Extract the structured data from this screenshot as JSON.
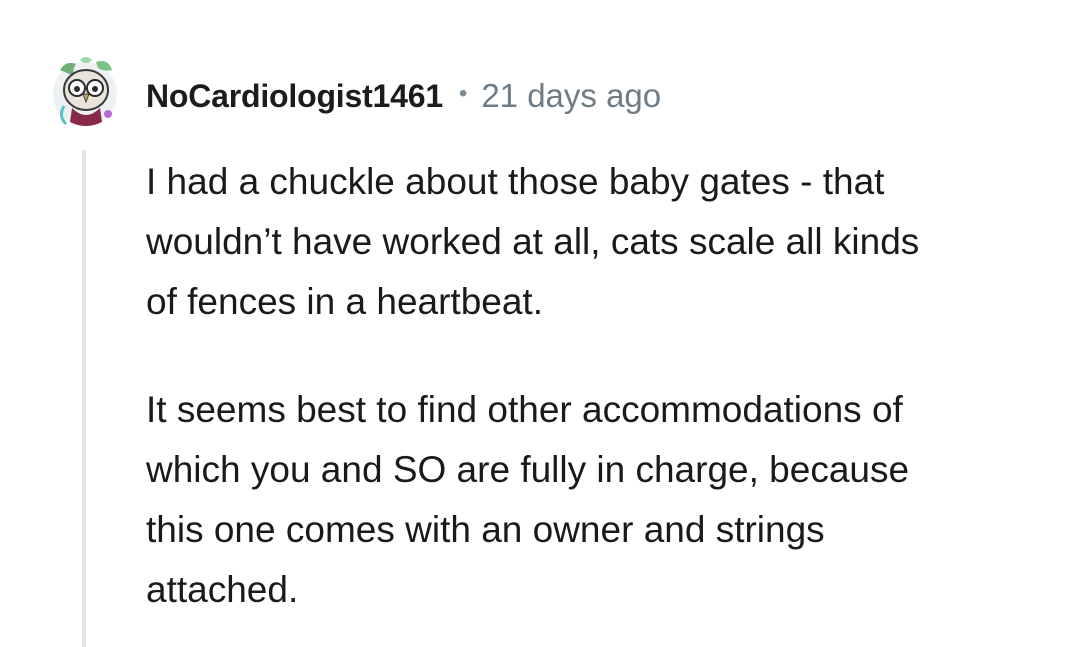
{
  "comment": {
    "author": "NoCardiologist1461",
    "separator": "•",
    "timestamp": "21 days ago",
    "paragraphs": [
      {
        "lines": [
          "I had a chuckle about those baby gates - that",
          "wouldn’t have worked at all, cats scale all kinds",
          "of fences in a heartbeat."
        ]
      },
      {
        "lines": [
          "It seems best to find other accommodations of",
          "which you and SO are fully in charge, because",
          "this one comes with an owner and strings",
          "attached."
        ]
      }
    ]
  },
  "colors": {
    "text": "#1a1a1b",
    "meta": "#6f7c85",
    "thread_line": "#e4e6e8"
  }
}
